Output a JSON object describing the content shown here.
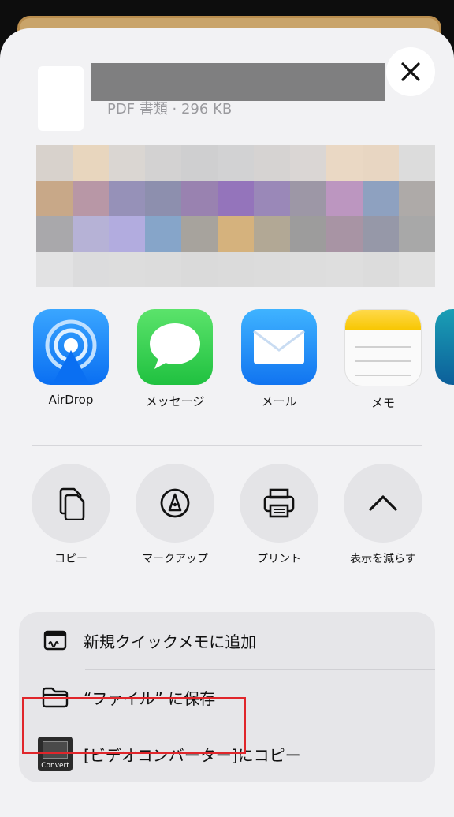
{
  "header": {
    "doc_meta": "PDF 書類 · 296 KB",
    "close_label": "×"
  },
  "apps": [
    {
      "label": "AirDrop",
      "icon": "airdrop-icon"
    },
    {
      "label": "メッセージ",
      "icon": "messages-icon"
    },
    {
      "label": "メール",
      "icon": "mail-icon"
    },
    {
      "label": "メモ",
      "icon": "notes-icon"
    }
  ],
  "actions": [
    {
      "label": "コピー",
      "icon": "copy-icon"
    },
    {
      "label": "マークアップ",
      "icon": "markup-icon"
    },
    {
      "label": "プリント",
      "icon": "print-icon"
    },
    {
      "label": "表示を減らす",
      "icon": "chevron-up-icon"
    }
  ],
  "list": [
    {
      "label": "新規クイックメモに追加",
      "icon": "quick-note-icon"
    },
    {
      "label": "“ファイル” に保存",
      "icon": "folder-icon"
    },
    {
      "label": "[ビデオコンバーター]にコピー",
      "icon": "video-converter-icon"
    }
  ],
  "video_converter_icon_text": "Convert",
  "colors": {
    "sheet_bg": "#f2f2f4",
    "highlight_border": "#e0262b",
    "card_bg": "#e6e6e9"
  }
}
